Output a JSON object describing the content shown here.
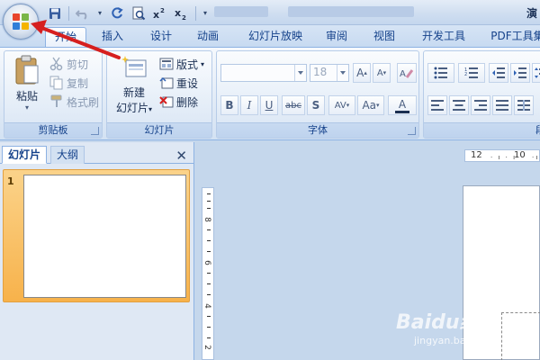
{
  "app": {
    "title_fragment": "演",
    "office_button": "office-logo"
  },
  "quick_access": {
    "items": [
      "save-icon",
      "undo-icon",
      "redo-icon",
      "print-preview-icon",
      "superscript-icon",
      "subscript-icon"
    ]
  },
  "tabs": [
    {
      "label": "开始",
      "active": true
    },
    {
      "label": "插入"
    },
    {
      "label": "设计"
    },
    {
      "label": "动画"
    },
    {
      "label": "幻灯片放映"
    },
    {
      "label": "审阅"
    },
    {
      "label": "视图"
    },
    {
      "label": "开发工具"
    },
    {
      "label": "PDF工具集"
    }
  ],
  "ribbon": {
    "clipboard": {
      "label": "剪贴板",
      "paste": "粘贴",
      "cut": "剪切",
      "copy": "复制",
      "format_painter": "格式刷"
    },
    "slides": {
      "label": "幻灯片",
      "new_slide_line1": "新建",
      "new_slide_line2": "幻灯片",
      "layout": "版式",
      "reset": "重设",
      "delete": "删除"
    },
    "font": {
      "label": "字体",
      "font_name": "",
      "font_size": "18",
      "bold": "B",
      "italic": "I",
      "underline": "U",
      "strike": "abc",
      "shadow": "S",
      "spacing": "AV",
      "case": "Aa",
      "color": "A",
      "grow": "A",
      "shrink": "A"
    },
    "paragraph": {
      "label": "段"
    }
  },
  "left_pane": {
    "tab_slides": "幻灯片",
    "tab_outline": "大纲",
    "close": "✕",
    "slide_number": "1"
  },
  "rulers": {
    "h_labels": [
      "12",
      "10"
    ],
    "v_labels": [
      "8",
      "6",
      "4",
      "2"
    ]
  },
  "watermark": {
    "brand": "Baidu经验",
    "url": "jingyan.baidu.com"
  },
  "colors": {
    "accent": "#15428b",
    "arrow": "#d61f1f",
    "selected_slide": "#f7b24b"
  }
}
